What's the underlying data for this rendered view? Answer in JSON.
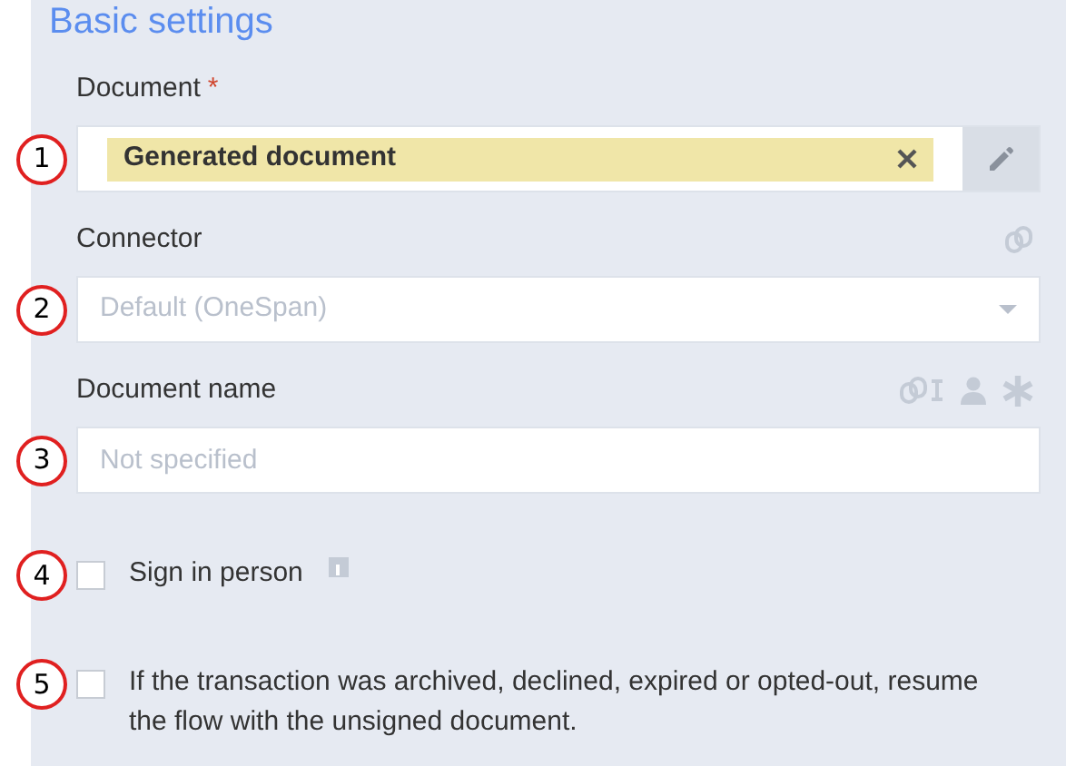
{
  "section_title": "Basic settings",
  "fields": [
    {
      "kind": "document",
      "callout": "1",
      "label": "Document",
      "required_mark": "*",
      "value": "Generated document"
    },
    {
      "kind": "select",
      "callout": "2",
      "label": "Connector",
      "placeholder": "Default (OneSpan)"
    },
    {
      "kind": "text",
      "callout": "3",
      "label": "Document name",
      "placeholder": "Not specified"
    },
    {
      "kind": "checkbox",
      "callout": "4",
      "label": "Sign in person",
      "checked": false,
      "info": true
    },
    {
      "kind": "checkbox",
      "callout": "5",
      "label": "If the transaction was archived, declined, expired or opted-out, resume the flow with the unsigned document.",
      "checked": false,
      "info": false
    }
  ]
}
